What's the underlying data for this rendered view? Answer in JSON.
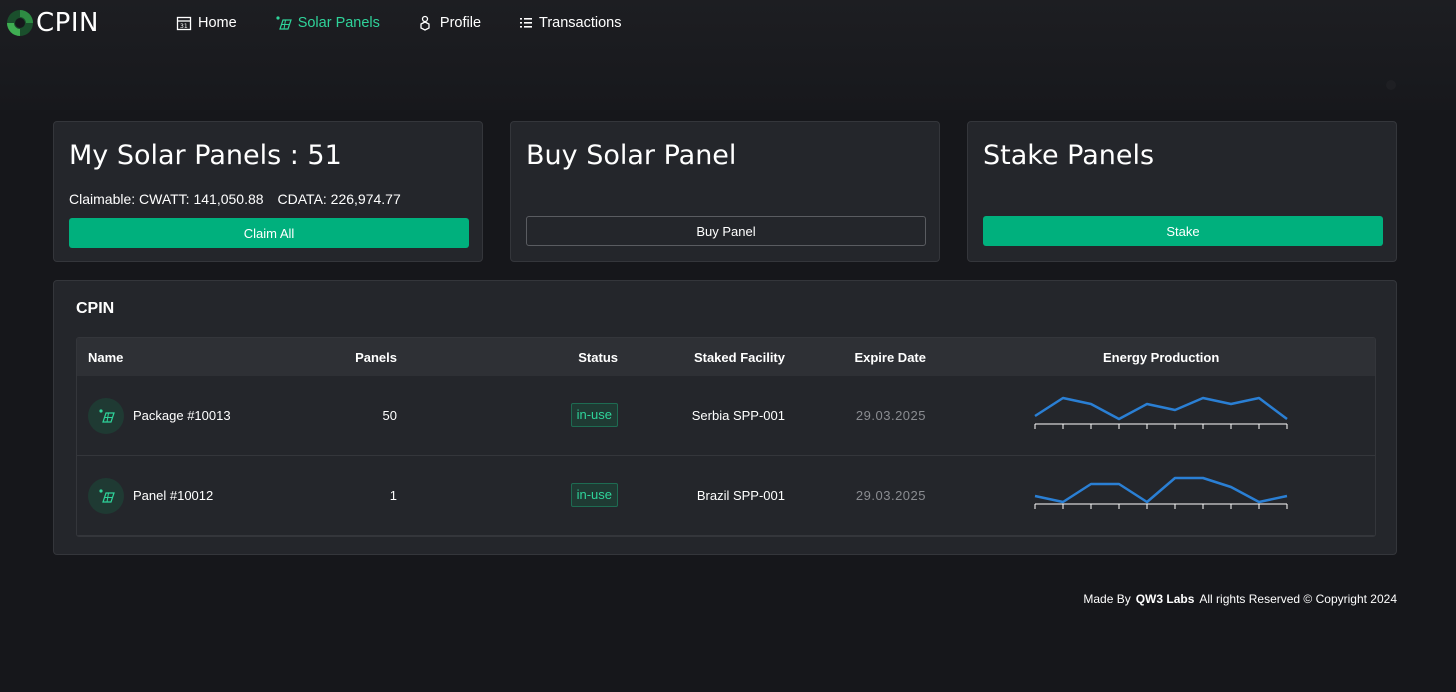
{
  "app": {
    "brand": "CPIN"
  },
  "nav": {
    "home": "Home",
    "solar_panels": "Solar Panels",
    "profile": "Profile",
    "transactions": "Transactions"
  },
  "cards": {
    "my_panels": {
      "title": "My Solar Panels : 51",
      "claimable": "Claimable: CWATT: 141,050.88",
      "cdata": "CDATA: 226,974.77",
      "button": "Claim All"
    },
    "buy": {
      "title": "Buy Solar Panel",
      "button": "Buy Panel"
    },
    "stake": {
      "title": "Stake Panels",
      "button": "Stake"
    }
  },
  "table": {
    "title": "CPIN",
    "headers": {
      "name": "Name",
      "panels": "Panels",
      "status": "Status",
      "facility": "Staked Facility",
      "expire": "Expire Date",
      "energy": "Energy Production"
    },
    "rows": [
      {
        "name": "Package #10013",
        "panels": "50",
        "status": "in-use",
        "facility": "Serbia SPP-001",
        "expire": "29.03.2025",
        "energy": [
          2,
          8,
          6,
          1,
          6,
          4,
          8,
          6,
          8,
          1
        ]
      },
      {
        "name": "Panel #10012",
        "panels": "1",
        "status": "in-use",
        "facility": "Brazil SPP-001",
        "expire": "29.03.2025",
        "energy": [
          2,
          0,
          6,
          6,
          0,
          8,
          8,
          5,
          0,
          2
        ]
      }
    ]
  },
  "colors": {
    "accent": "#00b07d",
    "active_nav": "#2fd39a",
    "spark": "#2a7fd4",
    "background": "#16171b",
    "card": "#24262b"
  },
  "footer": {
    "made_by": "Made By",
    "company": "QW3 Labs",
    "rights": "All rights Reserved © Copyright 2024"
  }
}
